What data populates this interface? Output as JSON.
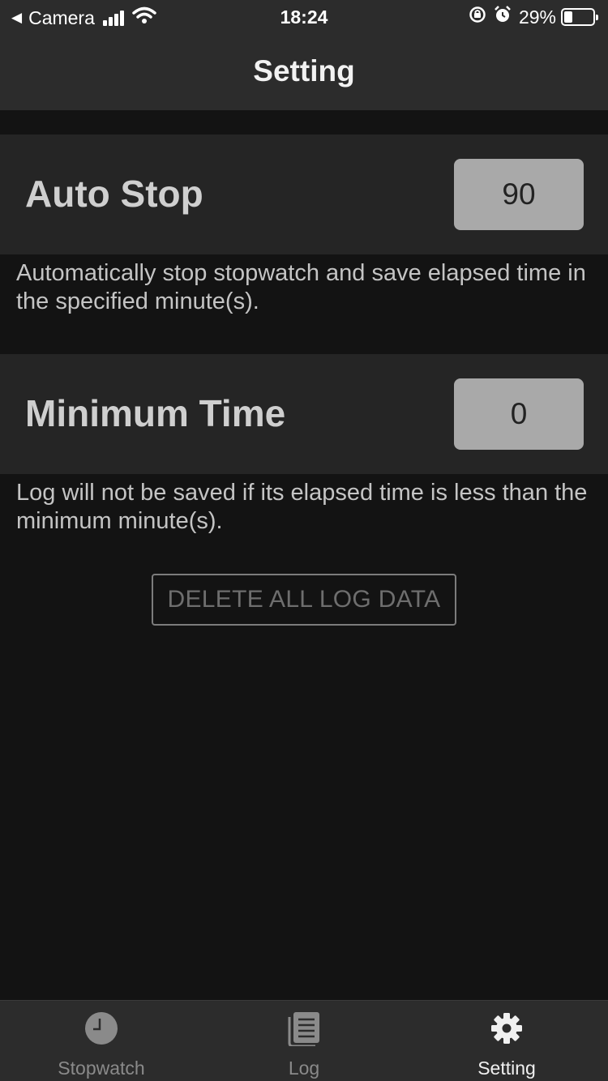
{
  "status_bar": {
    "back_app": "Camera",
    "time": "18:24",
    "battery_percent": "29%",
    "battery_level": 0.29,
    "icons": [
      "back-arrow-icon",
      "signal-icon",
      "wifi-icon",
      "orientation-lock-icon",
      "alarm-icon",
      "battery-icon"
    ]
  },
  "nav": {
    "title": "Setting"
  },
  "settings": {
    "auto_stop": {
      "label": "Auto Stop",
      "value": "90",
      "description": "Automatically stop stopwatch and save elapsed time in the specified minute(s)."
    },
    "minimum_time": {
      "label": "Minimum Time",
      "value": "0",
      "description": "Log will not be saved if its elapsed time is less than the minimum minute(s)."
    }
  },
  "delete_button": {
    "label": "DELETE ALL LOG DATA"
  },
  "tabs": [
    {
      "label": "Stopwatch",
      "icon": "clock-icon",
      "active": false
    },
    {
      "label": "Log",
      "icon": "log-list-icon",
      "active": false
    },
    {
      "label": "Setting",
      "icon": "gear-icon",
      "active": true
    }
  ],
  "colors": {
    "background": "#131313",
    "bar": "#2c2c2c",
    "row": "#252525",
    "value_box": "#a9a9a9",
    "active_tab": "#f0f0f0",
    "inactive_tab": "#8a8a8a"
  }
}
